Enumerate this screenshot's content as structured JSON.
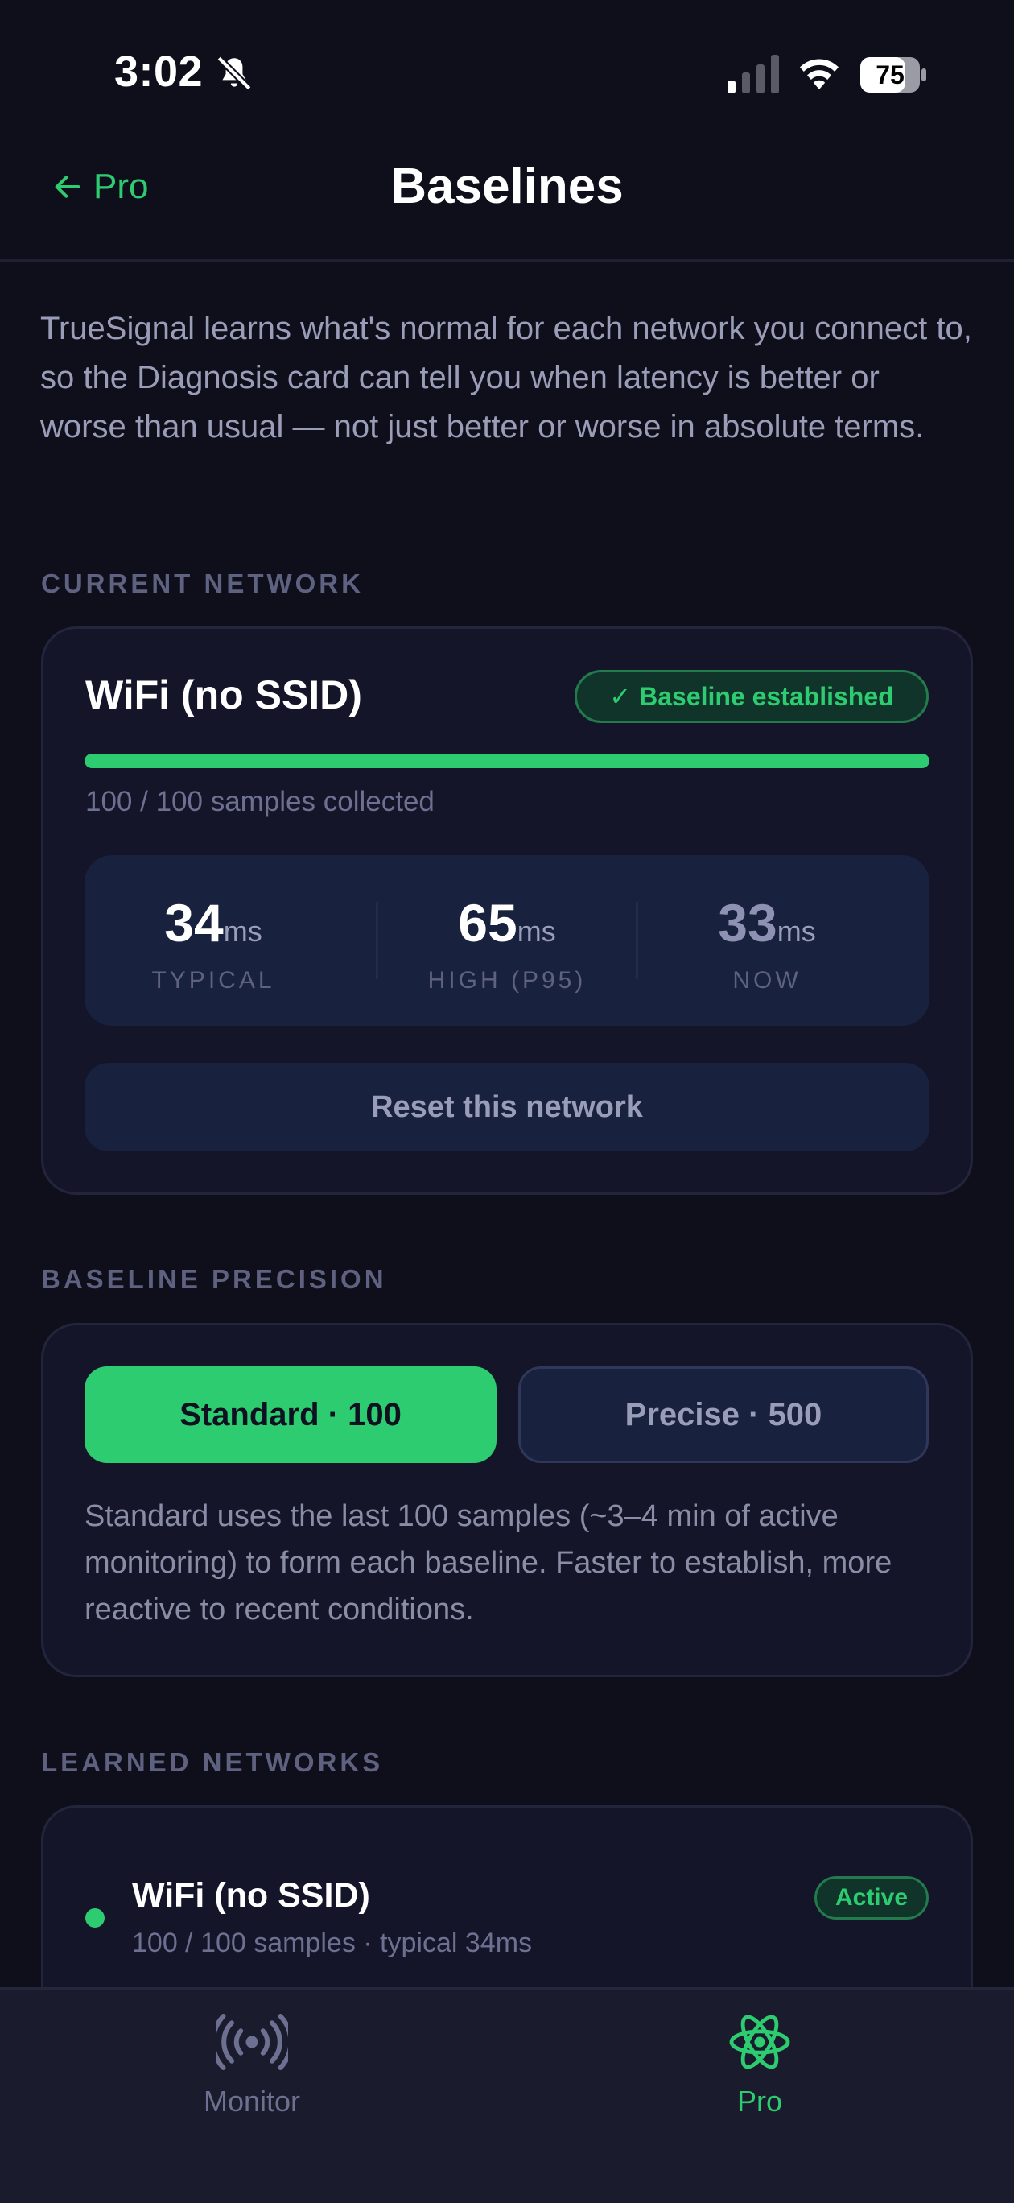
{
  "status_bar": {
    "time": "3:02",
    "battery": "75"
  },
  "nav": {
    "back_label": "Pro",
    "title": "Baselines"
  },
  "intro": "TrueSignal learns what's normal for each network you connect to, so the Diagnosis card can tell you when latency is better or worse than usual — not just better or worse in absolute terms.",
  "current_network": {
    "section_label": "CURRENT NETWORK",
    "name": "WiFi (no SSID)",
    "badge": "Baseline established",
    "progress_fraction": 1.0,
    "samples_text": "100 / 100 samples collected",
    "stats": [
      {
        "value": "34",
        "unit": "ms",
        "label": "TYPICAL"
      },
      {
        "value": "65",
        "unit": "ms",
        "label": "HIGH (P95)"
      },
      {
        "value": "33",
        "unit": "ms",
        "label": "NOW"
      }
    ],
    "reset_label": "Reset this network"
  },
  "precision": {
    "section_label": "BASELINE PRECISION",
    "standard_label": "Standard · 100",
    "precise_label": "Precise · 500",
    "selected": "standard",
    "description": "Standard uses the last 100 samples (~3–4 min of active monitoring) to form each baseline. Faster to establish, more reactive to recent conditions."
  },
  "learned": {
    "section_label": "LEARNED NETWORKS",
    "items": [
      {
        "name": "WiFi (no SSID)",
        "subtitle": "100 / 100 samples · typical 34ms",
        "badge": "Active"
      }
    ]
  },
  "tabs": [
    {
      "label": "Monitor",
      "icon": "broadcast-icon",
      "active": false
    },
    {
      "label": "Pro",
      "icon": "atom-icon",
      "active": true
    }
  ],
  "colors": {
    "accent": "#2ecc71",
    "background": "#0f0f1b",
    "card": "#141529"
  }
}
